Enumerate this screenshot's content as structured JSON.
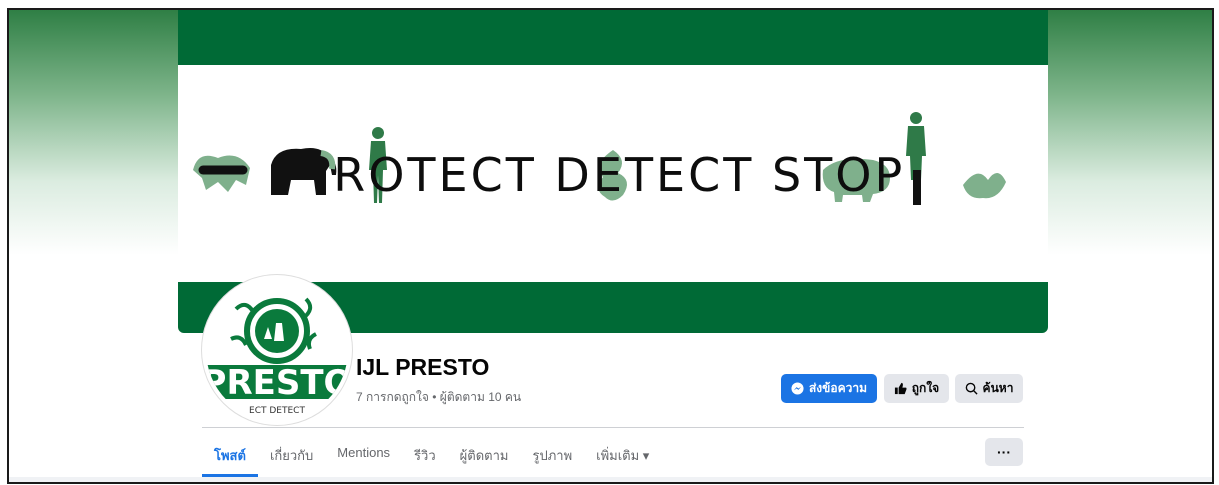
{
  "cover": {
    "banner_text": [
      "P",
      "R",
      "OT",
      "ECT D",
      "E",
      "TECT S",
      "T",
      "O",
      "P"
    ],
    "brand_green": "#006a36",
    "accent_green": "#7fb08c"
  },
  "avatar": {
    "logo_text": "PRESTO",
    "logo_subtext": "ECT DETECT"
  },
  "page": {
    "name": "IJL PRESTO",
    "stats": "7 การกดถูกใจ • ผู้ติดตาม 10 คน"
  },
  "actions": {
    "message_label": "ส่งข้อความ",
    "like_label": "ถูกใจ",
    "search_label": "ค้นหา",
    "more_label": "···"
  },
  "tabs": [
    {
      "label": "โพสต์",
      "active": true
    },
    {
      "label": "เกี่ยวกับ",
      "active": false
    },
    {
      "label": "Mentions",
      "active": false
    },
    {
      "label": "รีวิว",
      "active": false
    },
    {
      "label": "ผู้ติดตาม",
      "active": false
    },
    {
      "label": "รูปภาพ",
      "active": false
    },
    {
      "label": "เพิ่มเติม ▾",
      "active": false
    }
  ],
  "colors": {
    "primary_blue": "#1b74e4",
    "button_gray": "#e4e6eb",
    "text_secondary": "#65676b"
  }
}
